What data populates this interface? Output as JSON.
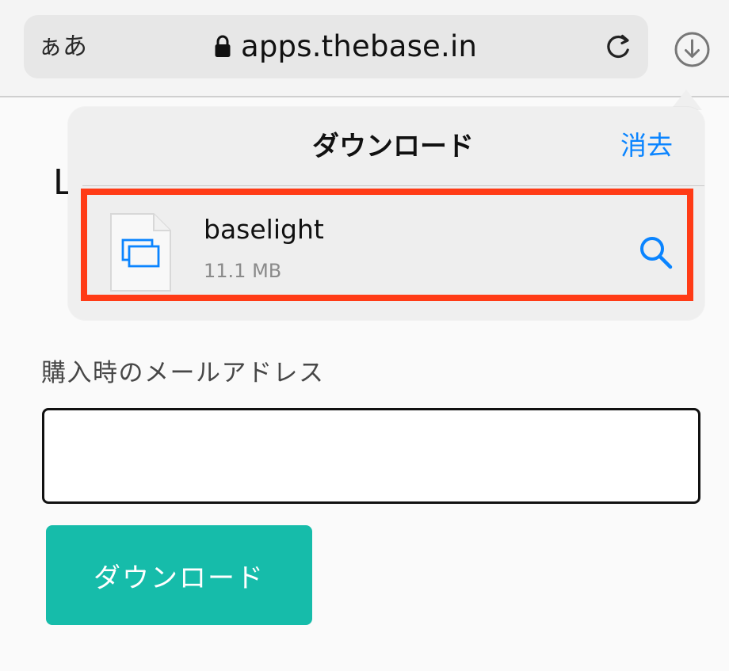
{
  "browser": {
    "reader_label": "ぁあ",
    "domain": "apps.thebase.in"
  },
  "page": {
    "partial_heading": "L",
    "email_label": "購入時のメールアドレス",
    "email_value": "",
    "download_button_label": "ダウンロード"
  },
  "downloads_popover": {
    "title": "ダウンロード",
    "clear_label": "消去",
    "items": [
      {
        "name": "baselight",
        "size": "11.1 MB"
      }
    ]
  },
  "colors": {
    "accent_blue": "#0a84ff",
    "highlight_red": "#ff3b16",
    "button_teal": "#16bcaa"
  },
  "icons": {
    "lock": "lock-icon",
    "reload": "reload-icon",
    "download": "download-circle-icon",
    "file": "file-document-icon",
    "magnify": "search-icon"
  }
}
